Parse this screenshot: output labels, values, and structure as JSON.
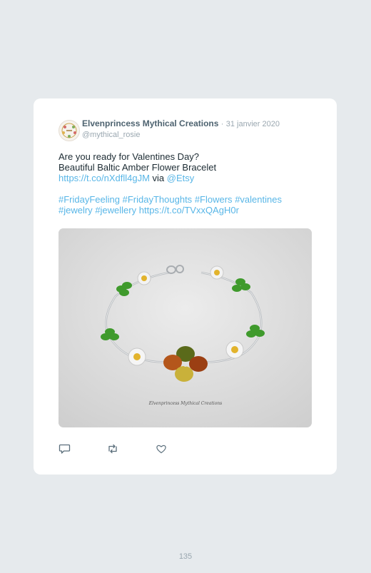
{
  "tweet": {
    "author_name": "Elvenprincess Mythical Creations",
    "separator": "·",
    "date": "31 janvier 2020",
    "handle": "@mythical_rosie",
    "lines": {
      "line1": "Are you ready for Valentines Day?",
      "line2": "Beautiful Baltic Amber Flower Bracelet",
      "link1": "https://t.co/nXdfll4gJM",
      "via": "via",
      "mention": "@Etsy",
      "hashtag1": "#FridayFeeling",
      "hashtag2": "#FridayThoughts",
      "hashtag3": "#Flowers",
      "hashtag4": "#valentines",
      "hashtag5": "#jewelry",
      "hashtag6": "#jewellery",
      "link2": "https://t.co/TVxxQAgH0r"
    },
    "photo_watermark": "Elvenprincess Mythical Creations",
    "actions": {
      "reply_icon": "reply-icon",
      "retweet_icon": "retweet-icon",
      "like_icon": "heart-icon"
    }
  },
  "page_number": "135",
  "colors": {
    "background": "#e6eaed",
    "link": "#58b6e7",
    "muted": "#9aa7b0",
    "text": "#1c2b33"
  }
}
